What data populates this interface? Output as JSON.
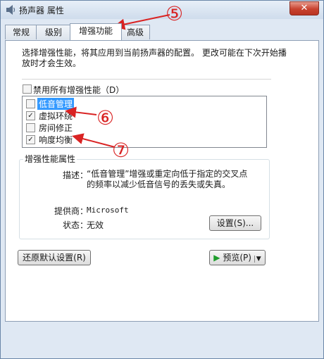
{
  "window": {
    "title": "扬声器 属性",
    "close_label": "✕"
  },
  "tabs": [
    "常规",
    "级别",
    "增强功能",
    "高级"
  ],
  "description": "选择增强性能，将其应用到当前扬声器的配置。 更改可能在下次开始播放时才会生效。",
  "disable_all": {
    "label": "禁用所有增强性能（D）",
    "checked": false
  },
  "enhancements": [
    {
      "label": "低音管理",
      "checked": false,
      "selected": true
    },
    {
      "label": "虚拟环绕",
      "checked": true,
      "selected": false
    },
    {
      "label": "房间修正",
      "checked": false,
      "selected": false
    },
    {
      "label": "响度均衡",
      "checked": true,
      "selected": false
    }
  ],
  "properties": {
    "title": "增强性能属性",
    "desc_label": "描述：",
    "desc_text": "“低音管理”增强或重定向低于指定的交叉点的频率以减少低音信号的丢失或失真。",
    "provider_label": "提供商：",
    "provider_value": "Microsoft",
    "status_label": "状态：",
    "status_value": "无效",
    "settings_button": "设置(S)..."
  },
  "restore_button": "还原默认设置(R)",
  "preview": {
    "play_icon": "▶",
    "label": "预览(P)",
    "arrow": "▼"
  },
  "annotations": [
    "⑤",
    "⑥",
    "⑦"
  ],
  "colors": {
    "selection": "#3399ff",
    "annotation": "#d92323",
    "close": "#c8422f",
    "play": "#1e9d2c"
  }
}
